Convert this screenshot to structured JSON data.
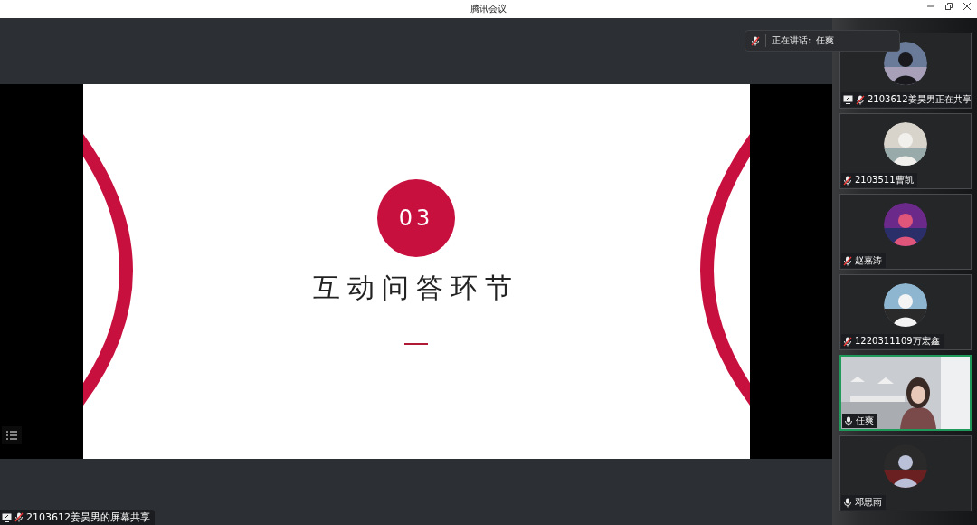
{
  "window": {
    "title": "腾讯会议"
  },
  "speaking_banner": {
    "label": "正在讲话:",
    "name": "任爽"
  },
  "slide": {
    "number": "03",
    "title": "互动问答环节"
  },
  "share_label": {
    "text": "2103612姜昊男的屏幕共享",
    "muted": true
  },
  "participants": [
    {
      "kind": "avatar",
      "name": "2103612姜昊男正在共享",
      "muted": true,
      "sharing": true,
      "speaking": false
    },
    {
      "kind": "avatar",
      "name": "2103511曹凯",
      "muted": true,
      "sharing": false,
      "speaking": false
    },
    {
      "kind": "avatar",
      "name": "赵嘉涛",
      "muted": true,
      "sharing": false,
      "speaking": false
    },
    {
      "kind": "avatar",
      "name": "1220311109万宏鑫",
      "muted": true,
      "sharing": false,
      "speaking": false
    },
    {
      "kind": "video",
      "name": "任爽",
      "muted": false,
      "sharing": false,
      "speaking": true
    },
    {
      "kind": "avatar",
      "name": "邓思雨",
      "muted": false,
      "sharing": false,
      "speaking": false
    }
  ]
}
